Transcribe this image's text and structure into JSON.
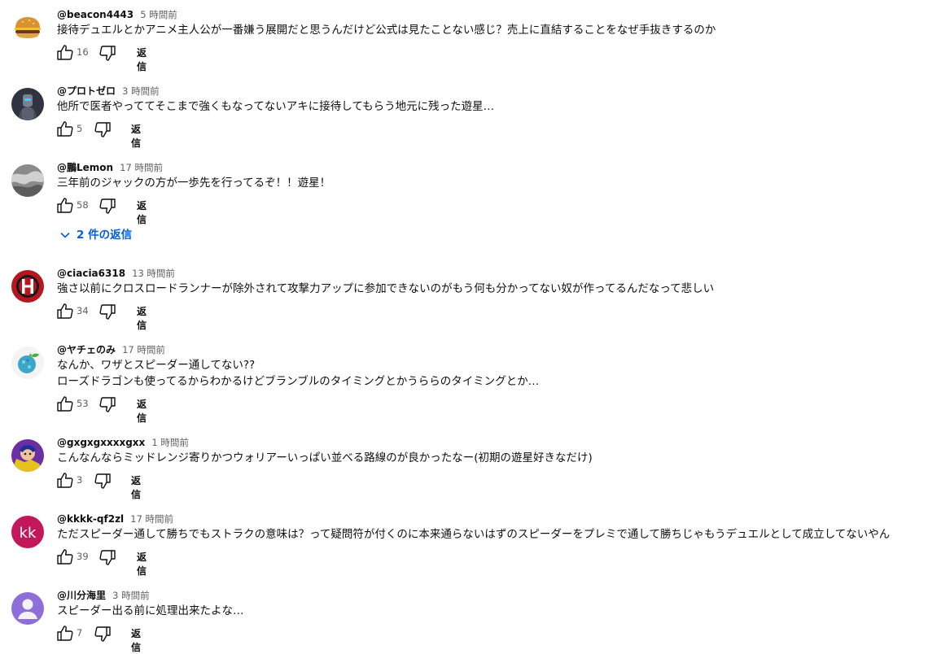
{
  "icons": {
    "like": "thumb-up-icon",
    "dislike": "thumb-down-icon",
    "expand": "chevron-down-icon"
  },
  "colors": {
    "link": "#065fd4",
    "secondary_text": "#606060"
  },
  "comments": [
    {
      "author": "@beacon4443",
      "time": "5 時間前",
      "lines": [
        "接待デュエルとかアニメ主人公が一番嫌う展開だと思うんだけど公式は見たことない感じ？売上に直結することをなぜ手抜きするのか"
      ],
      "likes": "16",
      "reply_label": "返信",
      "avatar": "burger"
    },
    {
      "author": "@プロトゼロ",
      "time": "3 時間前",
      "lines": [
        "他所で医者やっててそこまで強くもなってないアキに接待してもらう地元に残った遊星…"
      ],
      "likes": "5",
      "reply_label": "返信",
      "avatar": "robot"
    },
    {
      "author": "@鵬Lemon",
      "time": "17 時間前",
      "lines": [
        "三年前のジャックの方が一歩先を行ってるぞ！！遊星！"
      ],
      "likes": "58",
      "reply_label": "返信",
      "avatar": "gray",
      "replies_label": "2 件の返信"
    },
    {
      "author": "@ciacia6318",
      "time": "13 時間前",
      "lines": [
        "強さ以前にクロスロードランナーが除外されて攻撃力アップに参加できないのがもう何も分かってない奴が作ってるんだなって悲しい"
      ],
      "likes": "34",
      "reply_label": "返信",
      "avatar": "red-h"
    },
    {
      "author": "@ヤチェのみ",
      "time": "17 時間前",
      "lines": [
        "なんか、ワザとスピーダー通してない??",
        "ローズドラゴンも使ってるからわかるけどブランブルのタイミングとかうららのタイミングとか…"
      ],
      "likes": "53",
      "reply_label": "返信",
      "avatar": "berry"
    },
    {
      "author": "@gxgxgxxxxgxx",
      "time": "1 時間前",
      "lines": [
        "こんなんならミッドレンジ寄りかつウォリアーいっぱい並べる路線のが良かったなー(初期の遊星好きなだけ)"
      ],
      "likes": "3",
      "reply_label": "返信",
      "avatar": "character"
    },
    {
      "author": "@kkkk-qf2zl",
      "time": "17 時間前",
      "lines": [
        "ただスピーダー通して勝ちでもストラクの意味は？って疑問符が付くのに本来通らないはずのスピーダーをプレミで通して勝ちじゃもうデュエルとして成立してないやん"
      ],
      "likes": "39",
      "reply_label": "返信",
      "avatar": "kk",
      "avatar_text": "kk"
    },
    {
      "author": "@川分海里",
      "time": "3 時間前",
      "lines": [
        "スピーダー出る前に処理出来たよな…"
      ],
      "likes": "7",
      "reply_label": "返信",
      "avatar": "default"
    }
  ]
}
